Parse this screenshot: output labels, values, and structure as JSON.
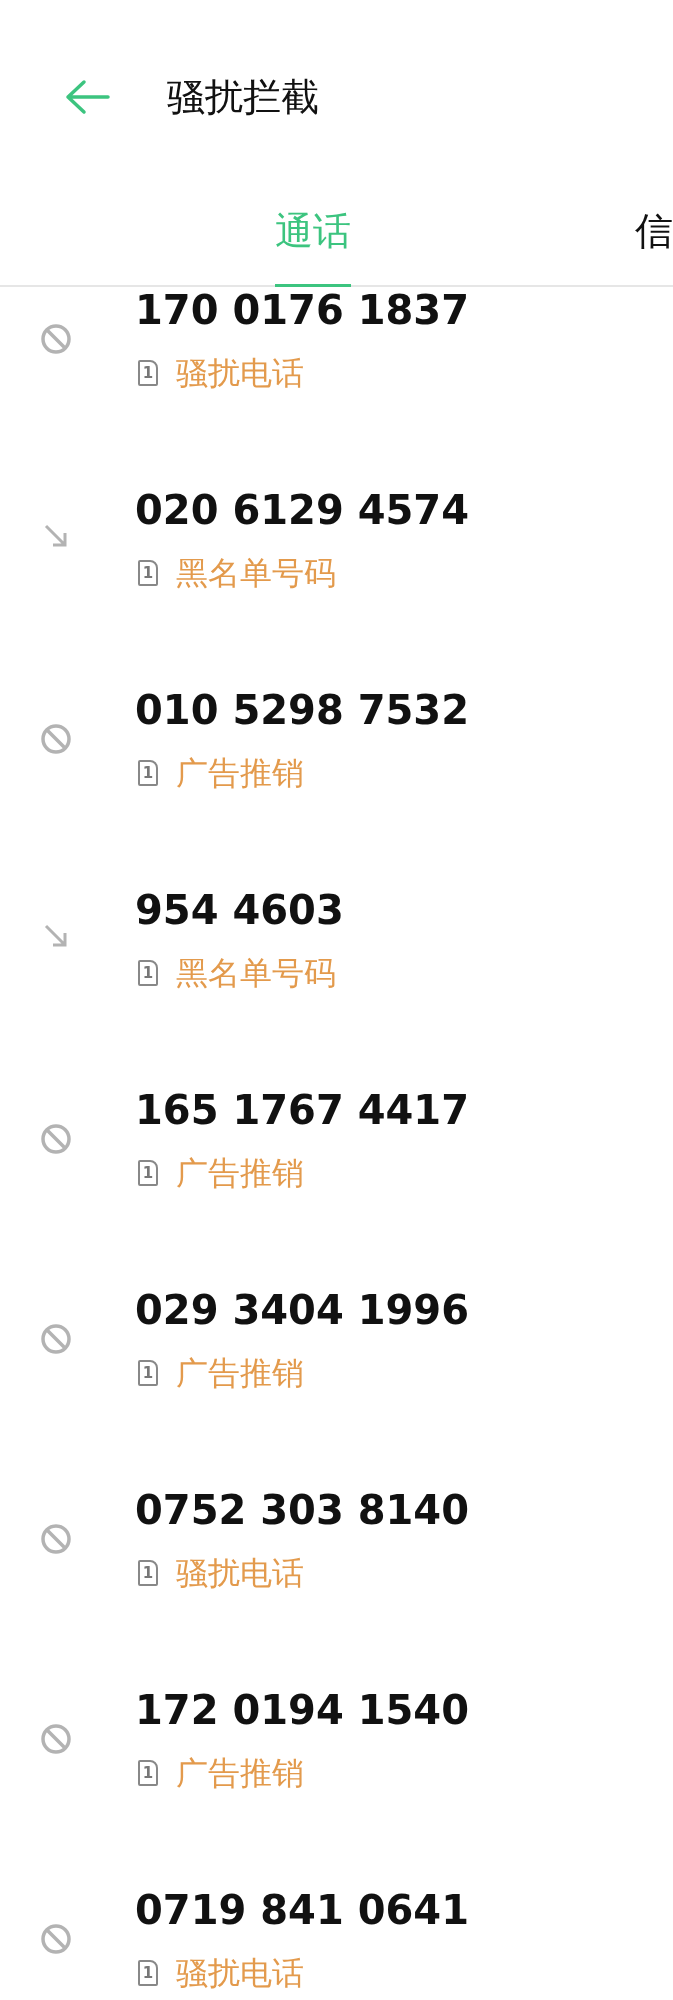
{
  "header": {
    "title": "骚扰拦截"
  },
  "tabs": [
    {
      "label": "通话",
      "selected": true
    },
    {
      "label": "信",
      "selected": false
    }
  ],
  "calls": [
    {
      "kind": "blocked",
      "number": "170 0176 1837",
      "sim": "1",
      "tag": "骚扰电话"
    },
    {
      "kind": "incoming",
      "number": "020 6129 4574",
      "sim": "1",
      "tag": "黑名单号码"
    },
    {
      "kind": "blocked",
      "number": "010 5298 7532",
      "sim": "1",
      "tag": "广告推销"
    },
    {
      "kind": "incoming",
      "number": "954 4603",
      "sim": "1",
      "tag": "黑名单号码"
    },
    {
      "kind": "blocked",
      "number": "165 1767 4417",
      "sim": "1",
      "tag": "广告推销"
    },
    {
      "kind": "blocked",
      "number": "029 3404 1996",
      "sim": "1",
      "tag": "广告推销"
    },
    {
      "kind": "blocked",
      "number": "0752 303 8140",
      "sim": "1",
      "tag": "骚扰电话"
    },
    {
      "kind": "blocked",
      "number": "172 0194 1540",
      "sim": "1",
      "tag": "广告推销"
    },
    {
      "kind": "blocked",
      "number": "0719 841 0641",
      "sim": "1",
      "tag": "骚扰电话"
    }
  ]
}
